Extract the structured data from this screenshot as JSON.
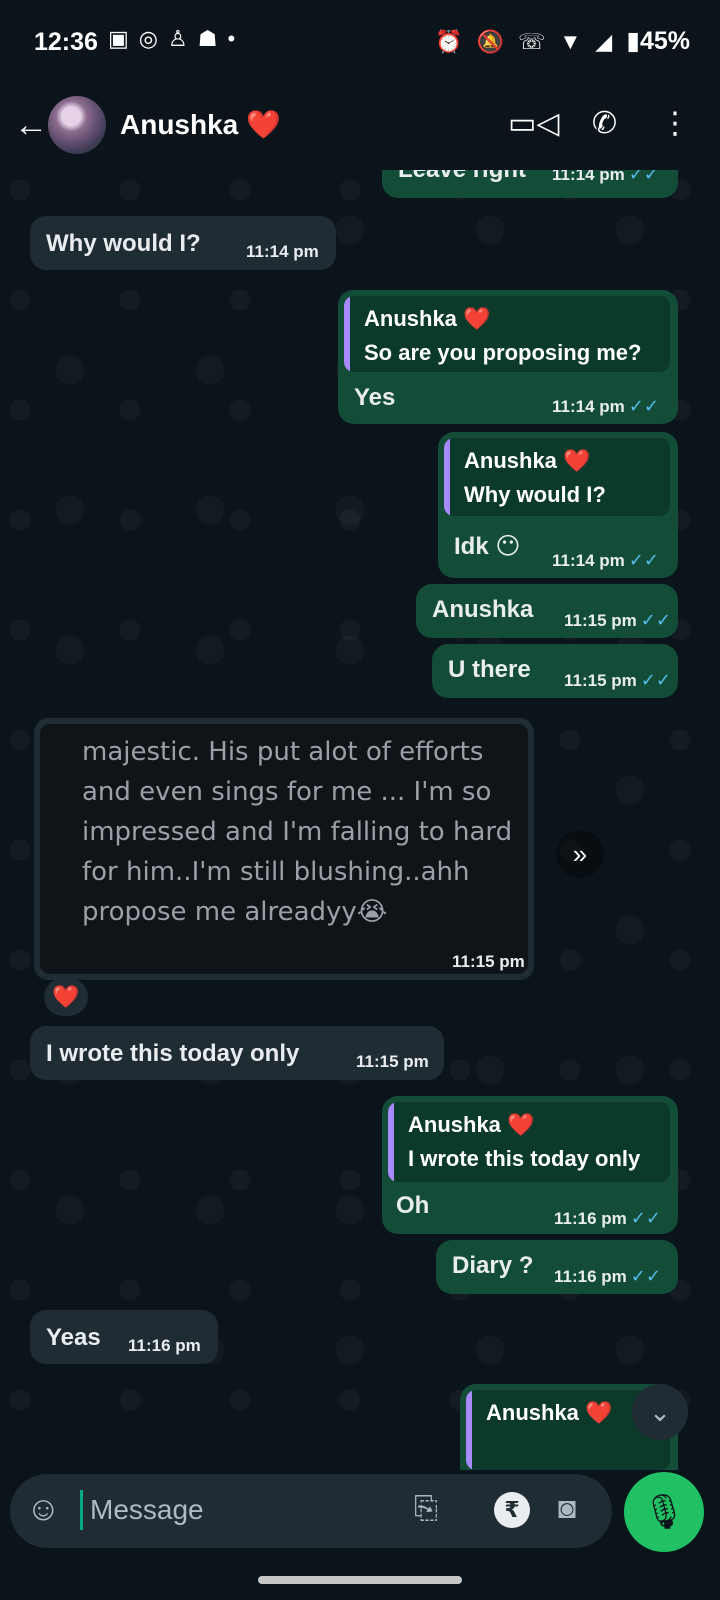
{
  "status_bar": {
    "time": "12:36",
    "left_icons": [
      "message-icon",
      "whatsapp-icon",
      "snapchat-icon",
      "discord-icon",
      "dot-icon"
    ],
    "right_icons": [
      "alarm-icon",
      "mute-icon",
      "wifi-call-icon",
      "wifi-icon",
      "signal-icon",
      "battery-icon"
    ],
    "battery": "45%"
  },
  "header": {
    "contact_name": "Anushka",
    "heart": "❤️",
    "icons": [
      "back-arrow-icon",
      "video-call-icon",
      "phone-call-icon",
      "more-icon"
    ]
  },
  "messages": [
    {
      "dir": "out",
      "text": "Leave right",
      "time": "11:14 pm"
    },
    {
      "dir": "in",
      "text": "Why would I?",
      "time": "11:14 pm"
    },
    {
      "dir": "out",
      "quote_name": "Anushka ❤️",
      "quote_text": "So are you proposing me?",
      "text": "Yes",
      "time": "11:14 pm"
    },
    {
      "dir": "out",
      "quote_name": "Anushka ❤️",
      "quote_text": "Why would I?",
      "text": "Idk 😶",
      "time": "11:14 pm"
    },
    {
      "dir": "out",
      "text": "Anushka",
      "time": "11:15 pm"
    },
    {
      "dir": "out",
      "text": "U there",
      "time": "11:15 pm"
    },
    {
      "dir": "in",
      "type": "image",
      "image_text": "majestic. His put alot of efforts and even sings for me ... I'm so impressed and I'm falling to hard for him..I'm still blushing..ahh propose me alreadyy😭",
      "time": "11:15 pm",
      "reaction": "❤️"
    },
    {
      "dir": "in",
      "text": "I wrote this today only",
      "time": "11:15 pm"
    },
    {
      "dir": "out",
      "quote_name": "Anushka ❤️",
      "quote_text": "I wrote this today only",
      "text": "Oh",
      "time": "11:16 pm"
    },
    {
      "dir": "out",
      "text": "Diary ?",
      "time": "11:16 pm"
    },
    {
      "dir": "in",
      "text": "Yeas",
      "time": "11:16 pm"
    },
    {
      "dir": "out",
      "quote_name": "Anushka ❤️",
      "partial": true
    }
  ],
  "input": {
    "placeholder": "Message",
    "rupee_symbol": "₹"
  },
  "colors": {
    "background": "#0b141a",
    "incoming_bubble": "#202c33",
    "outgoing_bubble": "#134d37",
    "read_ticks": "#53bdeb",
    "quote_bar": "#a78bfa",
    "mic_button": "#21c063"
  }
}
